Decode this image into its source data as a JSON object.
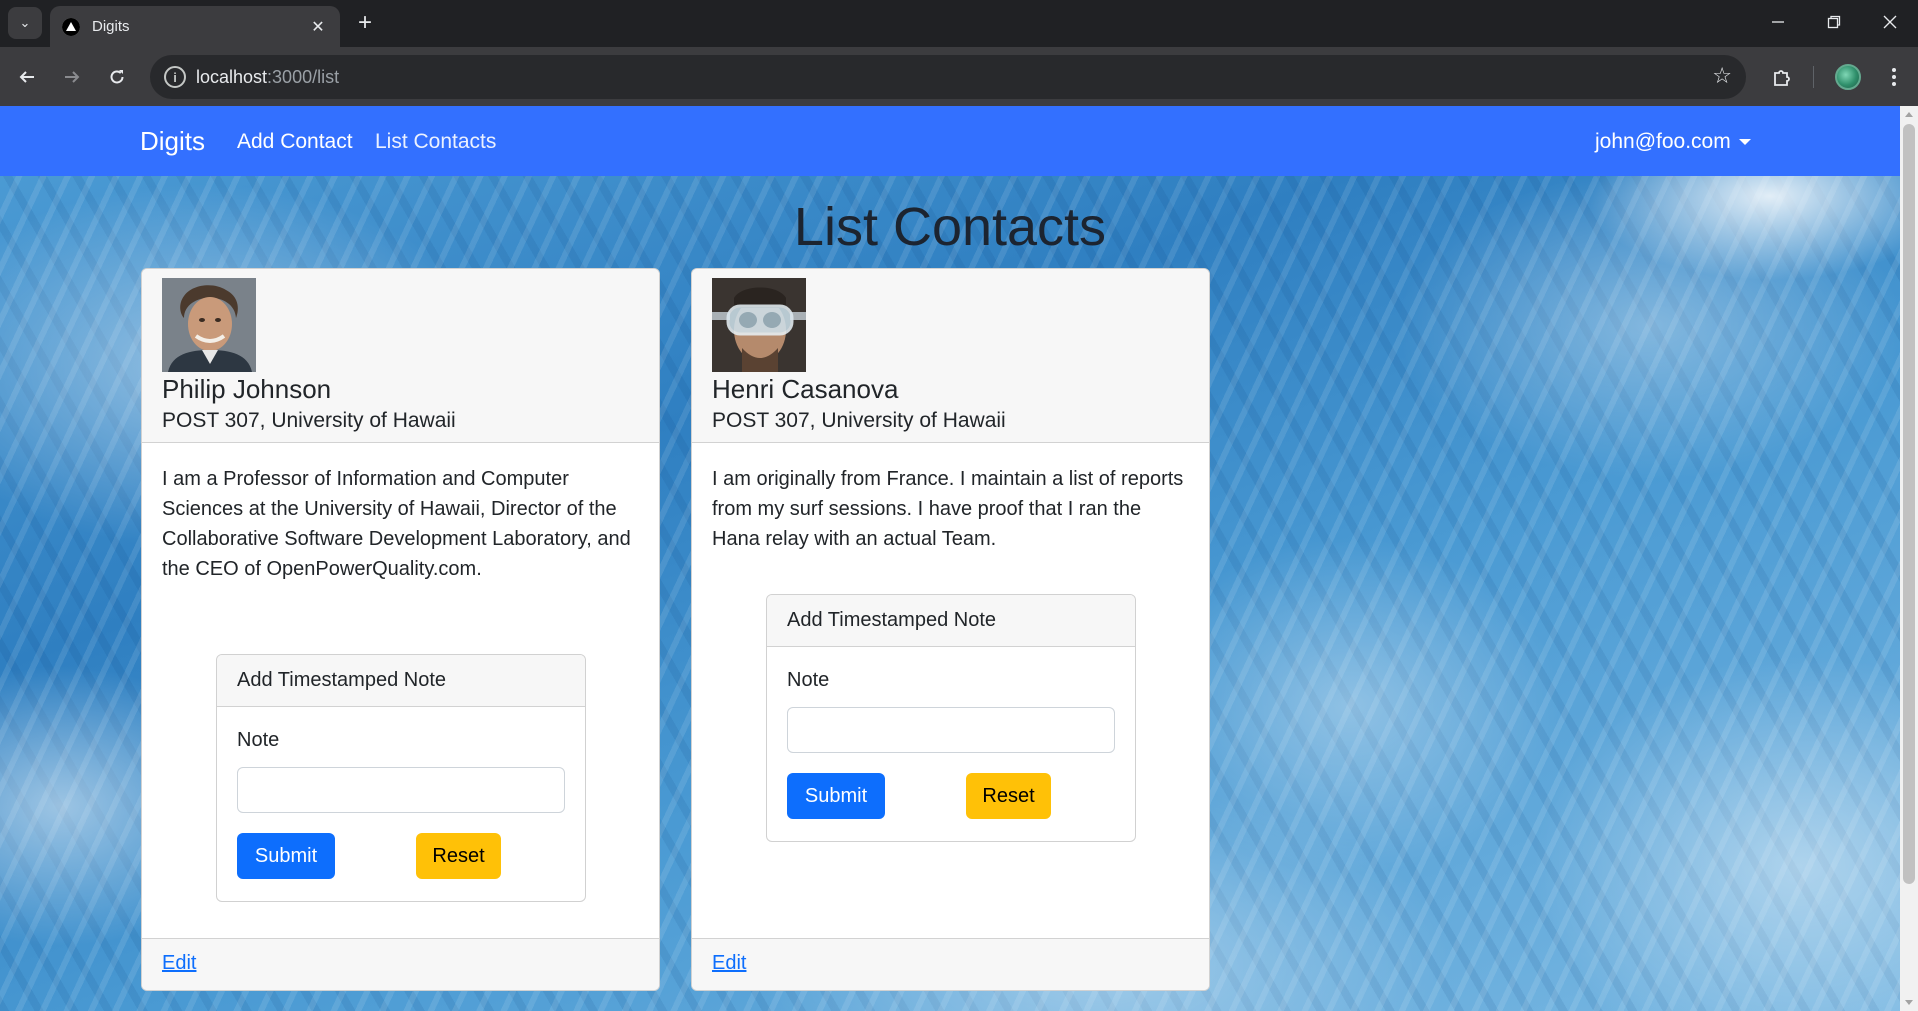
{
  "browser": {
    "tab_title": "Digits",
    "url_host": "localhost",
    "url_path": ":3000/list",
    "icons": {
      "tab_menu": "chevron-down-icon",
      "favicon": "triangle-logo-icon",
      "tab_close": "close-icon",
      "new_tab": "plus-icon",
      "back": "arrow-left-icon",
      "forward": "arrow-right-icon",
      "reload": "reload-icon",
      "site_info": "info-icon",
      "bookmark": "star-icon",
      "extensions": "puzzle-icon",
      "menu": "kebab-menu-icon",
      "minimize": "minimize-icon",
      "restore": "restore-icon",
      "close_window": "close-icon"
    }
  },
  "navbar": {
    "brand": "Digits",
    "links": [
      "Add Contact",
      "List Contacts"
    ],
    "user": "john@foo.com",
    "color": "#3370ff"
  },
  "page": {
    "title": "List Contacts"
  },
  "contacts": [
    {
      "name": "Philip Johnson",
      "address": "POST 307, University of Hawaii",
      "description": "I am a Professor of Information and Computer Sciences at the University of Hawaii, Director of the Collaborative Software Development Laboratory, and the CEO of OpenPowerQuality.com.",
      "note_form": {
        "title": "Add Timestamped Note",
        "label": "Note",
        "value": "",
        "submit": "Submit",
        "reset": "Reset"
      },
      "edit": "Edit"
    },
    {
      "name": "Henri Casanova",
      "address": "POST 307, University of Hawaii",
      "description": "I am originally from France. I maintain a list of reports from my surf sessions. I have proof that I ran the Hana relay with an actual Team.",
      "note_form": {
        "title": "Add Timestamped Note",
        "label": "Note",
        "value": "",
        "submit": "Submit",
        "reset": "Reset"
      },
      "edit": "Edit"
    }
  ],
  "colors": {
    "submit": "#0d6efd",
    "reset": "#ffc107",
    "link": "#0d6efd"
  }
}
